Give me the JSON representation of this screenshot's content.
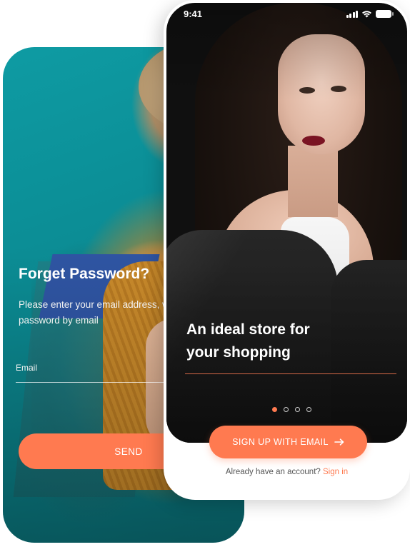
{
  "forgot_password": {
    "title": "Forget Password?",
    "description": "Please enter your email address, we will send your password by email",
    "email_label": "Email",
    "email_value": "",
    "send_label": "SEND"
  },
  "onboarding": {
    "status_time": "9:41",
    "headline_line1": "An ideal store for",
    "headline_line2": "your shopping",
    "carousel": {
      "pages": 4,
      "active_index": 0
    },
    "signup_label": "SIGN UP WITH EMAIL",
    "footer_prompt": "Already have an account?",
    "signin_label": "Sign in"
  },
  "colors": {
    "accent": "#ff7a50",
    "teal_background": "#0e9ba3",
    "text_dark": "#555555"
  },
  "icons": [
    "signal-icon",
    "wifi-icon",
    "battery-icon",
    "arrow-right-icon"
  ]
}
